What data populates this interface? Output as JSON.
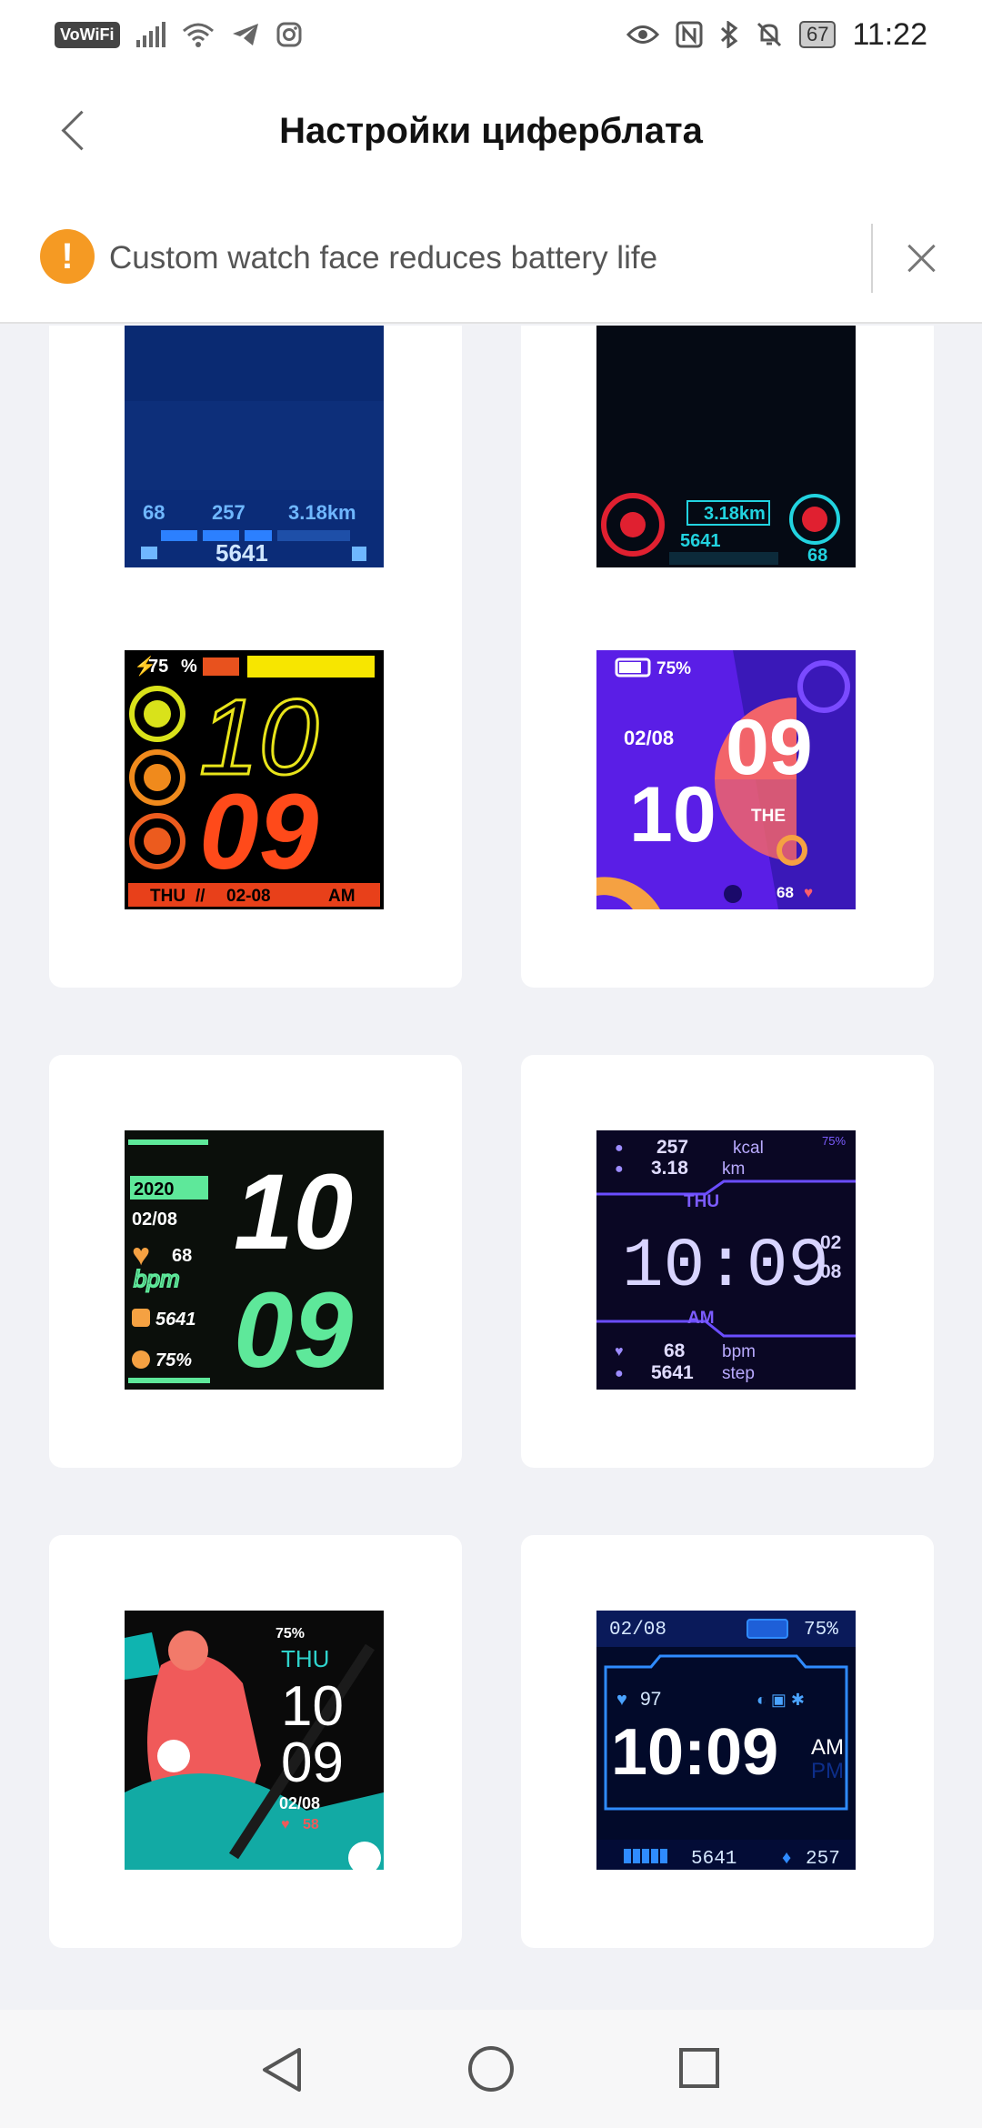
{
  "status_bar": {
    "vowifi": "VoWiFi",
    "battery": "67",
    "time": "11:22",
    "icons": [
      "signal-icon",
      "wifi-icon",
      "telegram-icon",
      "instagram-icon",
      "eye-icon",
      "nfc-icon",
      "bluetooth-icon",
      "mute-icon",
      "battery-icon"
    ]
  },
  "header": {
    "title": "Настройки циферблата",
    "back_icon": "chevron-left-icon"
  },
  "notice": {
    "icon": "warning-icon",
    "text": "Custom watch face reduces battery life",
    "close_icon": "close-icon"
  },
  "faces": {
    "f1": {
      "hr": "68",
      "cal": "257",
      "dist": "3.18km",
      "steps": "5641"
    },
    "f2": {
      "dist": "3.18km",
      "steps": "5641",
      "hr": "68"
    },
    "f3": {
      "battery": "75",
      "pct": "%",
      "hour": "10",
      "minute": "09",
      "day": "THU",
      "sep": "//",
      "date": "02-08",
      "ampm": "AM"
    },
    "f4": {
      "battery": "75%",
      "date": "02/08",
      "minute": "09",
      "hour": "10",
      "day": "THE",
      "hr": "68"
    },
    "f5": {
      "year": "2020",
      "date": "02/08",
      "hr": "68",
      "bpm": "bpm",
      "steps": "5641",
      "battery": "75%",
      "hour": "10",
      "minute": "09"
    },
    "f6": {
      "cal": "257",
      "cal_unit": "kcal",
      "dist": "3.18",
      "dist_unit": "km",
      "battery": "75%",
      "day": "THU",
      "time": "10:09",
      "month": "02",
      "daynum": "08",
      "ampm": "AM",
      "hr": "68",
      "hr_unit": "bpm",
      "steps": "5641",
      "steps_unit": "step"
    },
    "f7": {
      "battery": "75%",
      "day": "THU",
      "hour": "10",
      "minute": "09",
      "date": "02/08",
      "hr": "58"
    },
    "f8": {
      "date": "02/08",
      "battery": "75%",
      "hr": "97",
      "time": "10:09",
      "am": "AM",
      "pm": "PM",
      "steps": "5641",
      "cal": "257"
    }
  },
  "nav": {
    "back": "nav-back-icon",
    "home": "nav-home-icon",
    "recent": "nav-recent-icon"
  },
  "colors": {
    "accent": "#f59a23",
    "background": "#f1f2f6",
    "card": "#ffffff"
  }
}
